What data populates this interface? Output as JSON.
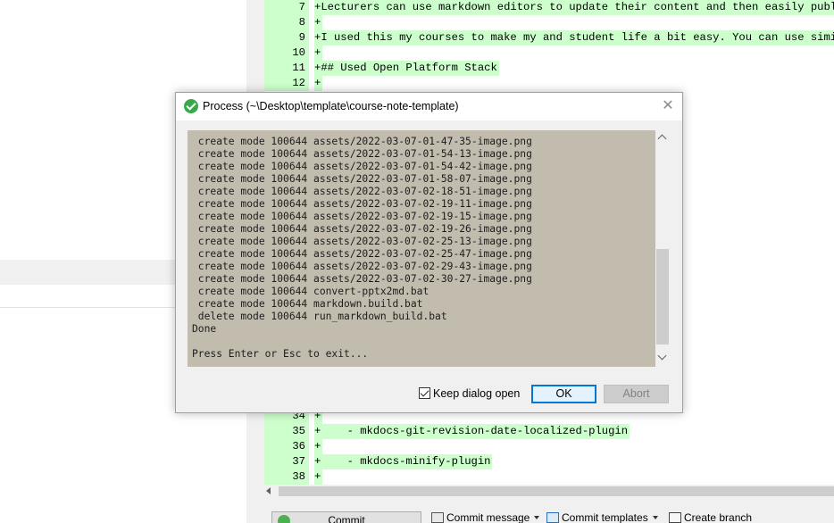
{
  "diff_top": [
    {
      "num": "7",
      "text": "+Lecturers can use markdown editors to update their content and then easily publish"
    },
    {
      "num": "8",
      "text": "+"
    },
    {
      "num": "9",
      "text": "+I used this my courses to make my and student life a bit easy. You can use similar"
    },
    {
      "num": "10",
      "text": "+"
    },
    {
      "num": "11",
      "text": "+## Used Open Platform Stack"
    },
    {
      "num": "12",
      "text": "+"
    }
  ],
  "diff_bottom": [
    {
      "num": "34",
      "text": "+"
    },
    {
      "num": "35",
      "text": "+    - mkdocs-git-revision-date-localized-plugin"
    },
    {
      "num": "36",
      "text": "+"
    },
    {
      "num": "37",
      "text": "+    - mkdocs-minify-plugin"
    },
    {
      "num": "38",
      "text": "+"
    }
  ],
  "dialog": {
    "title": "Process (~\\Desktop\\template\\course-note-template)",
    "close_glyph": "✕",
    "output_lines": [
      " create mode 100644 assets/2022-03-07-01-47-35-image.png",
      " create mode 100644 assets/2022-03-07-01-54-13-image.png",
      " create mode 100644 assets/2022-03-07-01-54-42-image.png",
      " create mode 100644 assets/2022-03-07-01-58-07-image.png",
      " create mode 100644 assets/2022-03-07-02-18-51-image.png",
      " create mode 100644 assets/2022-03-07-02-19-11-image.png",
      " create mode 100644 assets/2022-03-07-02-19-15-image.png",
      " create mode 100644 assets/2022-03-07-02-19-26-image.png",
      " create mode 100644 assets/2022-03-07-02-25-13-image.png",
      " create mode 100644 assets/2022-03-07-02-25-47-image.png",
      " create mode 100644 assets/2022-03-07-02-29-43-image.png",
      " create mode 100644 assets/2022-03-07-02-30-27-image.png",
      " create mode 100644 convert-pptx2md.bat",
      " create mode 100644 markdown.build.bat",
      " delete mode 100644 run_markdown_build.bat",
      "Done",
      "",
      "Press Enter or Esc to exit..."
    ],
    "keep_open_label": "Keep dialog open",
    "keep_open_checked": true,
    "ok_label": "OK",
    "abort_label": "Abort"
  },
  "bottom_bar": {
    "commit_label": "Commit",
    "commit_message_label": "Commit message",
    "commit_templates_label": "Commit templates",
    "create_branch_label": "Create branch"
  },
  "colors": {
    "added_line_bg": "#ccffcc",
    "console_bg": "#c2bcae",
    "ok_border": "#0078d7"
  }
}
